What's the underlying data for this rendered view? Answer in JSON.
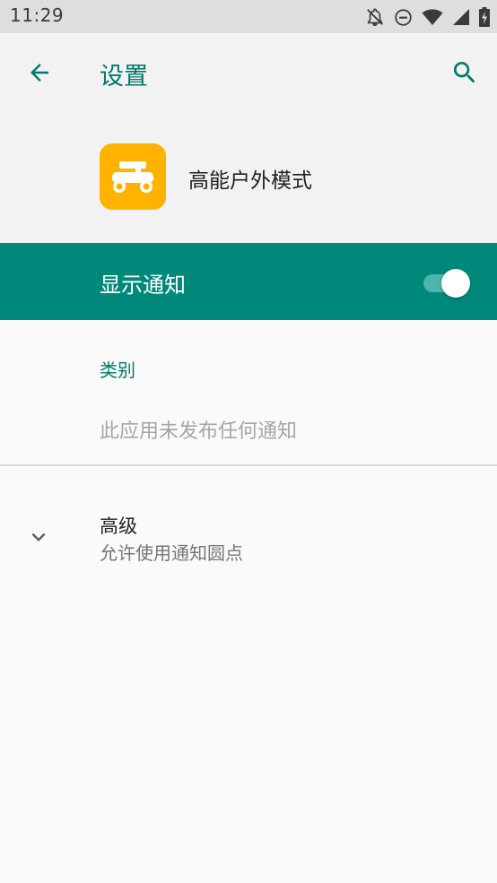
{
  "status_bar": {
    "time": "11:29",
    "icons": [
      "notifications-off-icon",
      "do-not-disturb-icon",
      "wifi-icon",
      "cellular-signal-icon",
      "battery-charging-icon"
    ]
  },
  "app_bar": {
    "title": "设置",
    "back_icon": "arrow-back-icon",
    "search_icon": "search-icon"
  },
  "app_header": {
    "app_name": "高能户外模式",
    "icon": "scooter-icon",
    "icon_color": "#ffb300"
  },
  "notifications_toggle": {
    "label": "显示通知",
    "state": "on",
    "accent": "#00897b"
  },
  "categories": {
    "title": "类别",
    "empty_text": "此应用未发布任何通知"
  },
  "advanced": {
    "title": "高级",
    "summary": "允许使用通知圆点",
    "icon": "chevron-down-icon"
  }
}
